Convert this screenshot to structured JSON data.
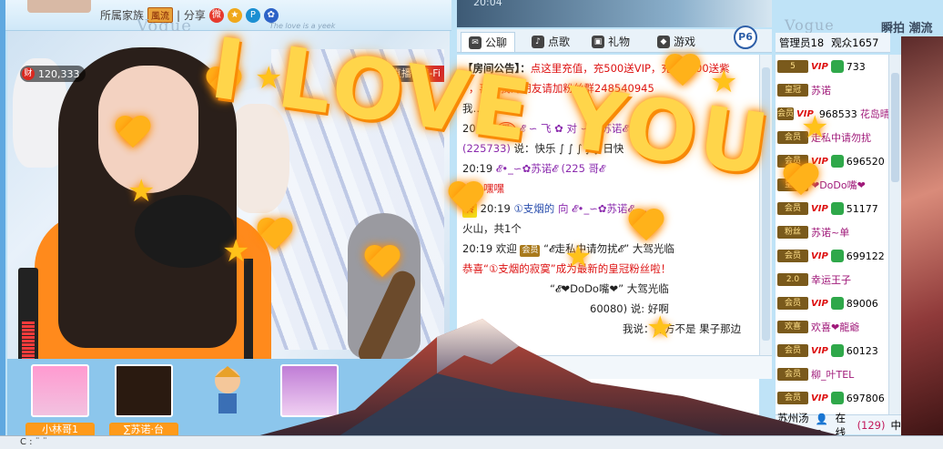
{
  "topbar": {
    "family_label": "所属家族",
    "family_badge": "風流",
    "share_label": "| 分享",
    "vogue": "Vogue",
    "subtitle": "The love is a yeek"
  },
  "video": {
    "wealth_icon": "财",
    "wealth_value": "120,333",
    "live_label": "直播",
    "hifi_label": "Hi-Fi",
    "volume_level": 0.45,
    "overlay_text": "I LOVE YOU"
  },
  "gifts": [
    {
      "label": "小林哥1"
    },
    {
      "label": "∑苏诺·台"
    },
    {
      "label": ""
    },
    {
      "label": ""
    }
  ],
  "chat": {
    "time": "20:04",
    "tabs": [
      {
        "icon": "chat-bubble-icon",
        "label": "公聊"
      },
      {
        "icon": "microphone-icon",
        "label": "点歌"
      },
      {
        "icon": "gift-icon",
        "label": "礼物"
      },
      {
        "icon": "gamepad-icon",
        "label": "游戏"
      }
    ],
    "p6_label": "P6",
    "announcement_prefix": "【房间公告】：",
    "announcement_text": "点这里充值，充500送VIP，充值2000送紫",
    "announcement_line2": "P，喜欢我的朋友请加粉丝群248540945",
    "lines": [
      {
        "a": "我",
        "b": "…共1个"
      },
      {
        "a": "20:19",
        "b": "𝓔 ∽ 飞 ✿ 对 ∽ ✿苏诺𝓔"
      },
      {
        "a": "(225733)",
        "b": "说：快乐 ∫ ∫ ∫ ∫ ∫ 日快"
      },
      {
        "a": "20:19",
        "b": "𝓔•_∽✿苏诺𝓔 (225",
        "c": "哥𝓔"
      },
      {
        "a": "说：",
        "b": "嘿嘿"
      },
      {
        "a": "20:19",
        "b": "①支烟的",
        "c": "向 𝓔•_∽✿苏诺𝓔 …"
      },
      {
        "a": "火山，共1个",
        "b": ""
      },
      {
        "a": "20:19 欢迎",
        "b": "“𝓔走私中请勿扰𝓔” 大驾光临"
      },
      {
        "a": "恭喜",
        "b": "“①支烟的寂寞”成为最新的皇冠粉丝啦！"
      },
      {
        "a": "",
        "b": "“𝓔❤DoDo嘴❤” 大驾光临"
      },
      {
        "a": "",
        "b": "60080) 说: 好啊"
      },
      {
        "a": "",
        "b": "我说：魔方不是  果子那边"
      }
    ]
  },
  "userlist": {
    "admins_label": "管理员18",
    "audience_label": "观众1657",
    "rows": [
      {
        "lv": "5",
        "num": "733",
        "name": ""
      },
      {
        "lv": "皇冠",
        "num": "",
        "name": "苏诺"
      },
      {
        "lv": "会员",
        "num": "968533",
        "name": "花岛晴儿"
      },
      {
        "lv": "会员",
        "num": "",
        "name": "走私中请勿扰"
      },
      {
        "lv": "会员",
        "num": "696520",
        "name": ""
      },
      {
        "lv": "皇冠",
        "num": "",
        "name": "❤DoDo嘴❤"
      },
      {
        "lv": "会员",
        "num": "51177",
        "name": ""
      },
      {
        "lv": "粉丝",
        "num": "",
        "name": "苏诺~单"
      },
      {
        "lv": "会员",
        "num": "699122",
        "name": ""
      },
      {
        "lv": "2.0",
        "num": "",
        "name": "幸运王子"
      },
      {
        "lv": "会员",
        "num": "89006",
        "name": ""
      },
      {
        "lv": "欢喜",
        "num": "",
        "name": "欢喜❤龍爺"
      },
      {
        "lv": "会员",
        "num": "60123",
        "name": ""
      },
      {
        "lv": "会员",
        "num": "",
        "name": "柳_叶TEL"
      },
      {
        "lv": "会员",
        "num": "697806",
        "name": ""
      }
    ],
    "footer_name": "苏州汤爷",
    "online_label": "在线",
    "online_count": "(129)",
    "middle_label": "中"
  },
  "right_panel": {
    "vogue": "Vogue",
    "text": "瞬拍 潮流"
  },
  "bottom": {
    "text": "C : ¨ ¨"
  }
}
